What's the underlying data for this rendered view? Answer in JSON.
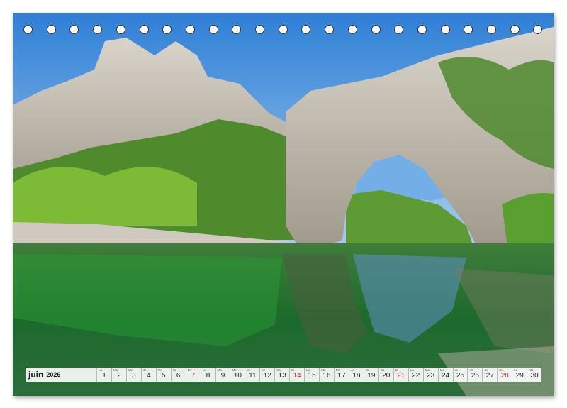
{
  "calendar": {
    "month": "juin",
    "year": "2026",
    "days": [
      {
        "dow": "Lu",
        "num": "1"
      },
      {
        "dow": "Ma",
        "num": "2"
      },
      {
        "dow": "Me",
        "num": "3"
      },
      {
        "dow": "Je",
        "num": "4"
      },
      {
        "dow": "Ve",
        "num": "5"
      },
      {
        "dow": "Sa",
        "num": "6"
      },
      {
        "dow": "Di",
        "num": "7",
        "sun": true
      },
      {
        "dow": "Lu",
        "num": "8"
      },
      {
        "dow": "Ma",
        "num": "9"
      },
      {
        "dow": "Me",
        "num": "10"
      },
      {
        "dow": "Je",
        "num": "11"
      },
      {
        "dow": "Ve",
        "num": "12"
      },
      {
        "dow": "Sa",
        "num": "13"
      },
      {
        "dow": "Di",
        "num": "14",
        "sun": true
      },
      {
        "dow": "Lu",
        "num": "15"
      },
      {
        "dow": "Ma",
        "num": "16"
      },
      {
        "dow": "Me",
        "num": "17"
      },
      {
        "dow": "Je",
        "num": "18"
      },
      {
        "dow": "Ve",
        "num": "19"
      },
      {
        "dow": "Sa",
        "num": "20"
      },
      {
        "dow": "Di",
        "num": "21",
        "sun": true
      },
      {
        "dow": "Lu",
        "num": "22"
      },
      {
        "dow": "Ma",
        "num": "23"
      },
      {
        "dow": "Me",
        "num": "24"
      },
      {
        "dow": "Je",
        "num": "25"
      },
      {
        "dow": "Ve",
        "num": "26"
      },
      {
        "dow": "Sa",
        "num": "27"
      },
      {
        "dow": "Di",
        "num": "28",
        "sun": true
      },
      {
        "dow": "Lu",
        "num": "29"
      },
      {
        "dow": "Ma",
        "num": "30"
      }
    ]
  },
  "colors": {
    "sunday": "#c0392b",
    "sky": "#4a8fd8",
    "water": "#1f6b2a",
    "rock": "#c8c2b6",
    "foliage": "#4e8f2a"
  }
}
